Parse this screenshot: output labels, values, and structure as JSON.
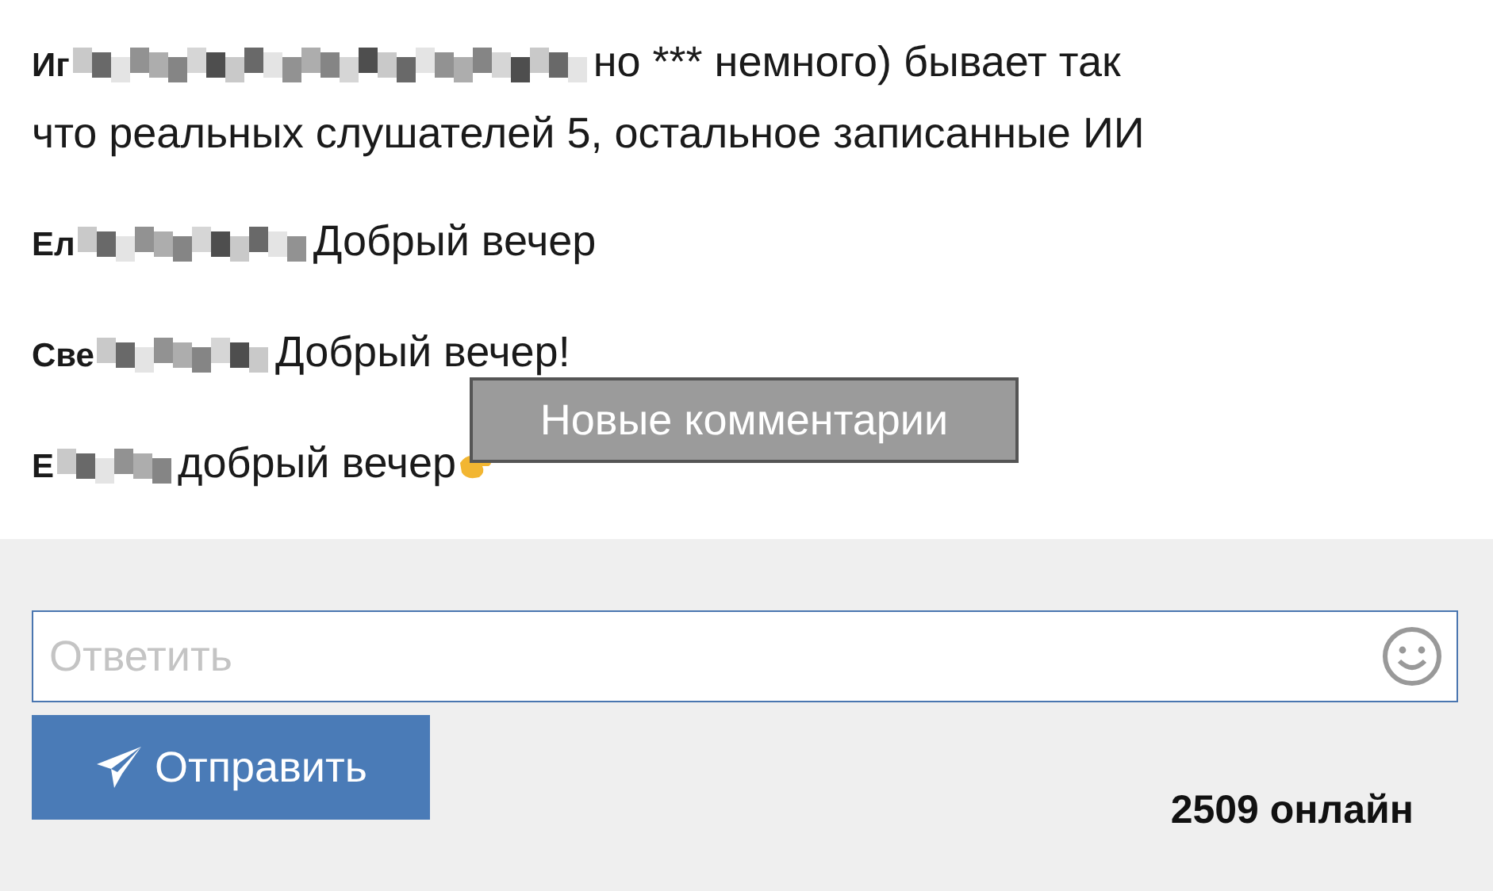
{
  "comments": [
    {
      "author": "Иг",
      "redacted": true,
      "lines": [
        "но *** немного) бывает так",
        "что реальных слушателей 5, остальное записанные ИИ"
      ],
      "emoji": false
    },
    {
      "author": "Ел",
      "redacted": true,
      "lines": [
        "Добрый вечер"
      ],
      "emoji": false
    },
    {
      "author": "Све",
      "redacted": true,
      "lines": [
        "Добрый вечер!"
      ],
      "emoji": false
    },
    {
      "author": "Е",
      "redacted": true,
      "lines": [
        "добрый вечер"
      ],
      "emoji": true
    }
  ],
  "new_comments_badge": "Новые комментарии",
  "reply": {
    "placeholder": "Ответить"
  },
  "send_button": "Отправить",
  "online": "2509 онлайн"
}
